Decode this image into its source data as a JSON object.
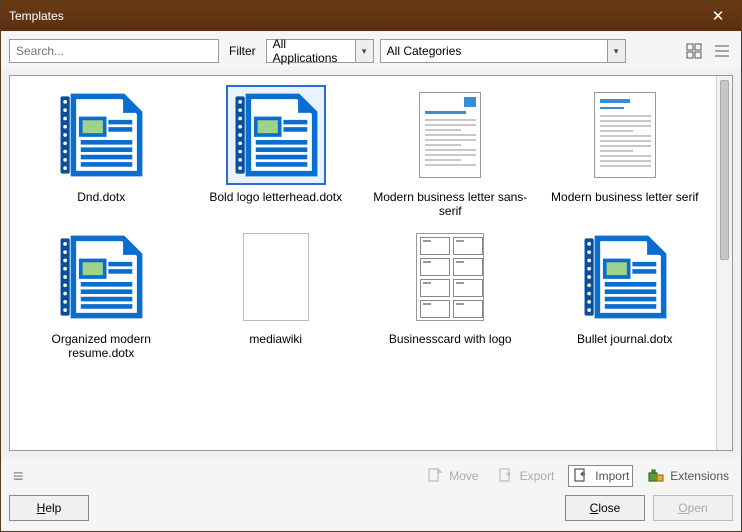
{
  "window": {
    "title": "Templates"
  },
  "toolbar": {
    "search_placeholder": "Search...",
    "filter_label": "Filter",
    "app_filter": "All Applications",
    "cat_filter": "All Categories"
  },
  "templates": [
    {
      "label": "Dnd.dotx",
      "kind": "docicon"
    },
    {
      "label": "Bold logo letterhead.dotx",
      "kind": "docicon",
      "selected": true
    },
    {
      "label": "Modern business letter sans-serif",
      "kind": "miniA"
    },
    {
      "label": "Modern business letter serif",
      "kind": "miniB"
    },
    {
      "label": "Organized modern resume.dotx",
      "kind": "docicon"
    },
    {
      "label": "mediawiki",
      "kind": "miniC"
    },
    {
      "label": "Businesscard with logo",
      "kind": "miniD"
    },
    {
      "label": "Bullet journal.dotx",
      "kind": "docicon"
    }
  ],
  "commands": {
    "move": "Move",
    "export": "Export",
    "import": "Import",
    "extensions": "Extensions"
  },
  "buttons": {
    "help": "Help",
    "close": "Close",
    "open": "Open"
  }
}
